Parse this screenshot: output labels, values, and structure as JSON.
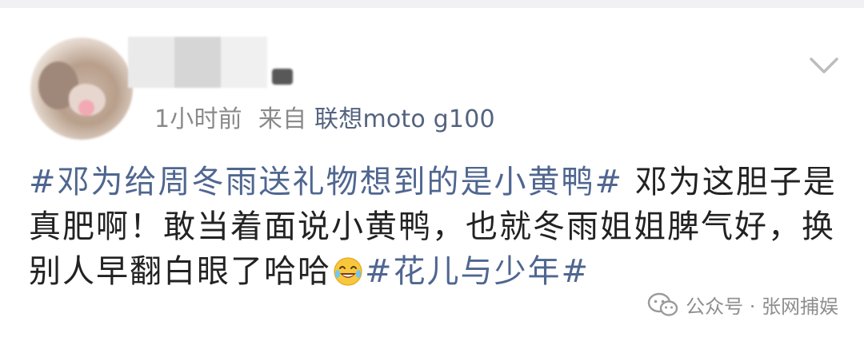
{
  "post": {
    "time": "1小时前",
    "source_prefix": "来自",
    "device": "联想moto g100",
    "text_parts": {
      "hashtag1": "#邓为给周冬雨送礼物想到的是小黄鸭#",
      "body": "邓为这胆子是真肥啊！敢当着面说小黄鸭，也就冬雨姐姐脾气好，换别人早翻白眼了哈哈",
      "hashtag2": "#花儿与少年#"
    }
  },
  "icons": {
    "avatar": "blurred-user-avatar",
    "username": "mosaic-blurred-username",
    "expand": "chevron-down-icon",
    "emoji": "laughing-tears-emoji",
    "watermark": "wechat-official-account-icon"
  },
  "watermark": {
    "text": "公众号 · 张网捕娱"
  },
  "colors": {
    "hashtag": "#4f6690",
    "meta_text": "#8a8a8a",
    "body_text": "#222222"
  }
}
